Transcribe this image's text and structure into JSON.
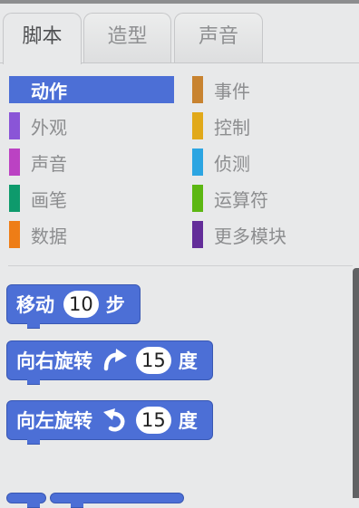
{
  "tabs": [
    {
      "label": "脚本"
    },
    {
      "label": "造型"
    },
    {
      "label": "声音"
    }
  ],
  "categories": [
    {
      "label": "动作",
      "color": "#4c6fd6"
    },
    {
      "label": "外观",
      "color": "#8a55d7"
    },
    {
      "label": "声音",
      "color": "#bb42c3"
    },
    {
      "label": "画笔",
      "color": "#0e9a6c"
    },
    {
      "label": "数据",
      "color": "#ee7d16"
    },
    {
      "label": "事件",
      "color": "#c88330"
    },
    {
      "label": "控制",
      "color": "#e1a91a"
    },
    {
      "label": "侦测",
      "color": "#2ca5e2"
    },
    {
      "label": "运算符",
      "color": "#5cb712"
    },
    {
      "label": "更多模块",
      "color": "#632d99"
    }
  ],
  "selected_category": "动作",
  "blocks": {
    "move": {
      "label": "移动",
      "value": "10",
      "suffix": "步"
    },
    "turn_right": {
      "label": "向右旋转",
      "icon": "rotate-clockwise-icon",
      "value": "15",
      "suffix": "度"
    },
    "turn_left": {
      "label": "向左旋转",
      "icon": "rotate-counterclockwise-icon",
      "value": "15",
      "suffix": "度"
    }
  }
}
